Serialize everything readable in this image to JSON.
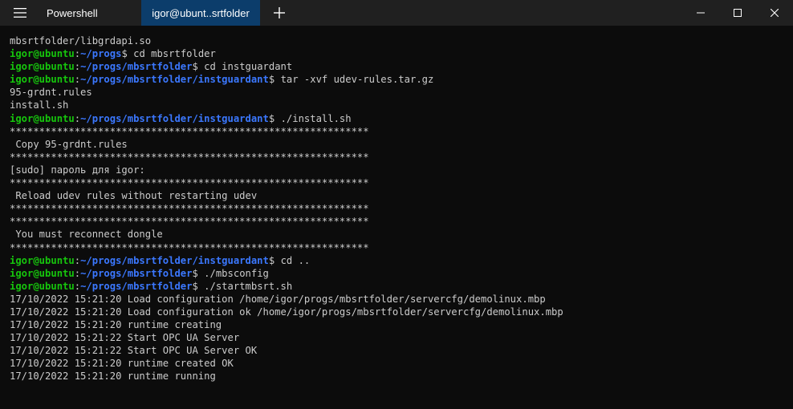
{
  "titlebar": {
    "tabs": [
      {
        "label": "Powershell",
        "active": false
      },
      {
        "label": "igor@ubunt..srtfolder",
        "active": true
      }
    ],
    "icons": {
      "menu": "hamburger-menu-icon",
      "new_tab": "plus-icon",
      "minimize": "minimize-icon",
      "maximize": "maximize-icon",
      "close": "close-icon"
    }
  },
  "colors": {
    "background": "#0c0c0c",
    "titlebar": "#202020",
    "active_tab": "#0c3d6b",
    "user": "#16c60c",
    "path": "#3b78ff",
    "text": "#cccccc"
  },
  "terminal": {
    "lines": [
      {
        "type": "text",
        "text": "mbsrtfolder/libgrdapi.so"
      },
      {
        "type": "prompt",
        "user": "igor@ubuntu",
        "path": "~/progs",
        "cmd": "cd mbsrtfolder"
      },
      {
        "type": "prompt",
        "user": "igor@ubuntu",
        "path": "~/progs/mbsrtfolder",
        "cmd": "cd instguardant"
      },
      {
        "type": "prompt",
        "user": "igor@ubuntu",
        "path": "~/progs/mbsrtfolder/instguardant",
        "cmd": "tar -xvf udev-rules.tar.gz"
      },
      {
        "type": "text",
        "text": "95-grdnt.rules"
      },
      {
        "type": "text",
        "text": "install.sh"
      },
      {
        "type": "prompt",
        "user": "igor@ubuntu",
        "path": "~/progs/mbsrtfolder/instguardant",
        "cmd": "./install.sh"
      },
      {
        "type": "text",
        "text": "*************************************************************"
      },
      {
        "type": "text",
        "text": " Copy 95-grdnt.rules"
      },
      {
        "type": "text",
        "text": "*************************************************************"
      },
      {
        "type": "text",
        "text": "[sudo] пароль для igor:"
      },
      {
        "type": "text",
        "text": "*************************************************************"
      },
      {
        "type": "text",
        "text": " Reload udev rules without restarting udev"
      },
      {
        "type": "text",
        "text": "*************************************************************"
      },
      {
        "type": "text",
        "text": "*************************************************************"
      },
      {
        "type": "text",
        "text": " You must reconnect dongle"
      },
      {
        "type": "text",
        "text": "*************************************************************"
      },
      {
        "type": "prompt",
        "user": "igor@ubuntu",
        "path": "~/progs/mbsrtfolder/instguardant",
        "cmd": "cd .."
      },
      {
        "type": "prompt",
        "user": "igor@ubuntu",
        "path": "~/progs/mbsrtfolder",
        "cmd": "./mbsconfig"
      },
      {
        "type": "prompt",
        "user": "igor@ubuntu",
        "path": "~/progs/mbsrtfolder",
        "cmd": "./startmbsrt.sh"
      },
      {
        "type": "text",
        "text": "17/10/2022 15:21:20 Load configuration /home/igor/progs/mbsrtfolder/servercfg/demolinux.mbp"
      },
      {
        "type": "text",
        "text": "17/10/2022 15:21:20 Load configuration ok /home/igor/progs/mbsrtfolder/servercfg/demolinux.mbp"
      },
      {
        "type": "text",
        "text": "17/10/2022 15:21:20 runtime creating"
      },
      {
        "type": "text",
        "text": "17/10/2022 15:21:22 Start OPC UA Server"
      },
      {
        "type": "text",
        "text": "17/10/2022 15:21:22 Start OPC UA Server OK"
      },
      {
        "type": "text",
        "text": "17/10/2022 15:21:20 runtime created OK"
      },
      {
        "type": "text",
        "text": "17/10/2022 15:21:20 runtime running"
      }
    ]
  }
}
